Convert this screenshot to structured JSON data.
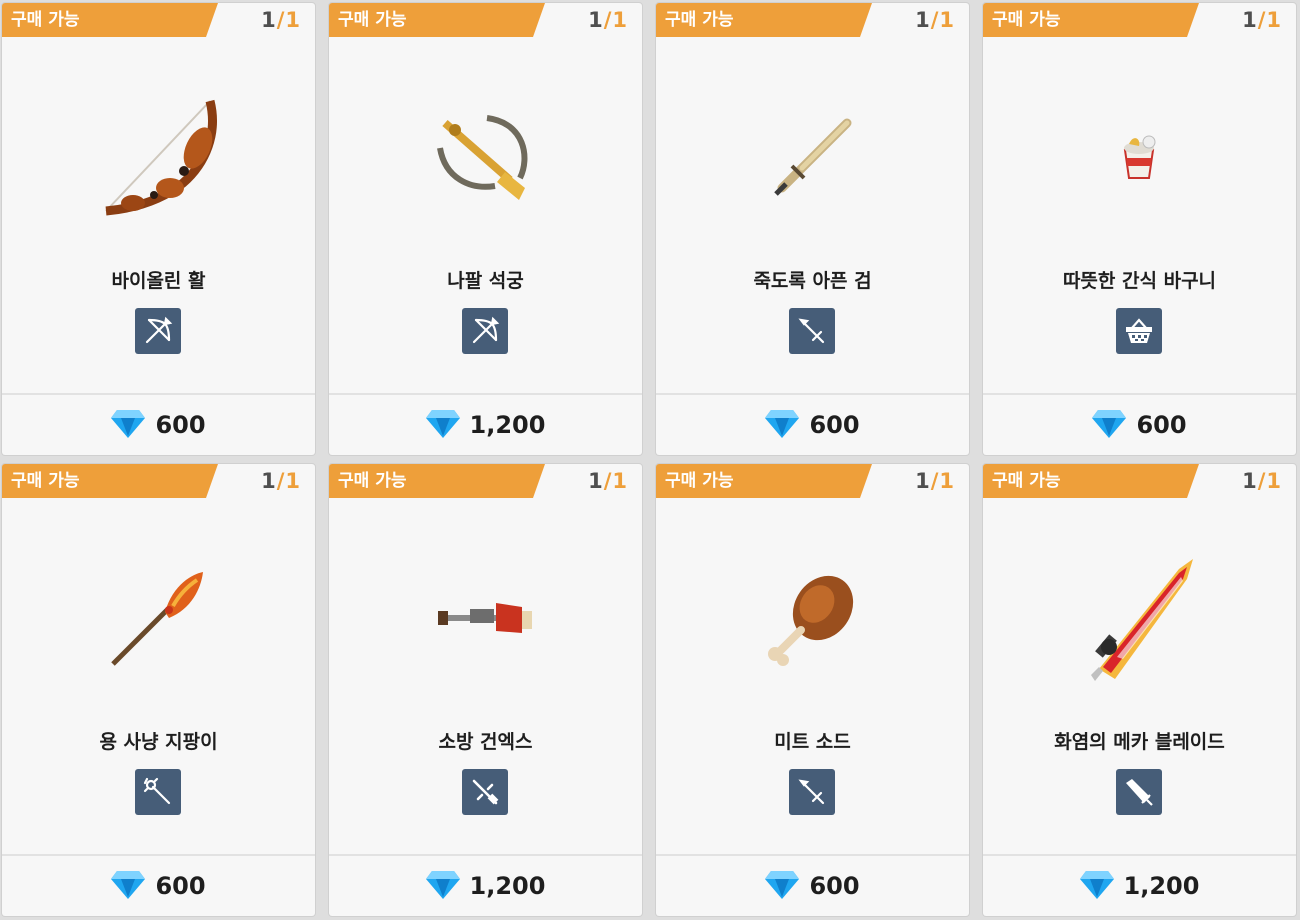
{
  "shop": {
    "items": [
      {
        "status": "구매 가능",
        "bought": "1",
        "limit": "1",
        "name": "바이올린 활",
        "type_icon": "bow-icon",
        "price": "600",
        "currency_icon": "diamond-icon"
      },
      {
        "status": "구매 가능",
        "bought": "1",
        "limit": "1",
        "name": "나팔 석궁",
        "type_icon": "bow-icon",
        "price": "1,200",
        "currency_icon": "diamond-icon"
      },
      {
        "status": "구매 가능",
        "bought": "1",
        "limit": "1",
        "name": "죽도록 아픈 검",
        "type_icon": "sword-icon",
        "price": "600",
        "currency_icon": "diamond-icon"
      },
      {
        "status": "구매 가능",
        "bought": "1",
        "limit": "1",
        "name": "따뜻한 간식 바구니",
        "type_icon": "basket-icon",
        "price": "600",
        "currency_icon": "diamond-icon"
      },
      {
        "status": "구매 가능",
        "bought": "1",
        "limit": "1",
        "name": "용 사냥 지팡이",
        "type_icon": "staff-icon",
        "price": "600",
        "currency_icon": "diamond-icon"
      },
      {
        "status": "구매 가능",
        "bought": "1",
        "limit": "1",
        "name": "소방 건엑스",
        "type_icon": "rifle-icon",
        "price": "1,200",
        "currency_icon": "diamond-icon"
      },
      {
        "status": "구매 가능",
        "bought": "1",
        "limit": "1",
        "name": "미트 소드",
        "type_icon": "sword-icon",
        "price": "600",
        "currency_icon": "diamond-icon"
      },
      {
        "status": "구매 가능",
        "bought": "1",
        "limit": "1",
        "name": "화염의 메카 블레이드",
        "type_icon": "greatsword-icon",
        "price": "1,200",
        "currency_icon": "diamond-icon"
      }
    ]
  },
  "colors": {
    "badge": "#ee9f3a",
    "type_tile": "#465d78",
    "diamond": "#1fa6f0",
    "card": "#f7f7f7"
  }
}
